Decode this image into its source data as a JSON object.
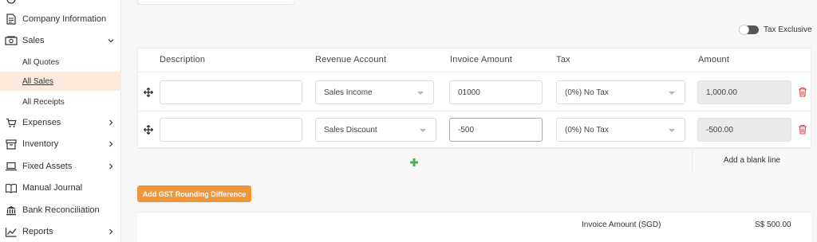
{
  "sidebar": {
    "items": [
      {
        "label": "Company Information",
        "icon": "document-icon"
      },
      {
        "label": "Sales",
        "icon": "cash-icon"
      },
      {
        "label": "Expenses",
        "icon": "cart-icon"
      },
      {
        "label": "Inventory",
        "icon": "archive-icon"
      },
      {
        "label": "Fixed Assets",
        "icon": "laptop-icon"
      },
      {
        "label": "Manual Journal",
        "icon": "book-icon"
      },
      {
        "label": "Bank Reconciliation",
        "icon": "bank-icon"
      },
      {
        "label": "Reports",
        "icon": "chart-icon"
      }
    ],
    "sales_sub": [
      "All Quotes",
      "All Sales",
      "All Receipts"
    ],
    "active_sub": "All Sales"
  },
  "tax_toggle": {
    "label": "Tax Exclusive",
    "on": false
  },
  "table": {
    "headers": [
      "Description",
      "Revenue Account",
      "Invoice Amount",
      "Tax",
      "Amount"
    ],
    "rows": [
      {
        "description": "",
        "account": "Sales Income",
        "invoice_amount": "01000",
        "tax": "(0%) No Tax",
        "amount": "1,000.00"
      },
      {
        "description": "",
        "account": "Sales Discount",
        "invoice_amount": "-500",
        "tax": "(0%) No Tax",
        "amount": "-500.00"
      }
    ]
  },
  "add_blank_line": "Add a blank line",
  "gst_button": "Add GST Rounding Difference",
  "summary": {
    "label": "Invoice Amount (SGD)",
    "value": "S$ 500.00"
  },
  "colors": {
    "accent": "#f0963a",
    "active_bg": "#fcebdd",
    "add": "#4caf50",
    "delete": "#e04040"
  }
}
